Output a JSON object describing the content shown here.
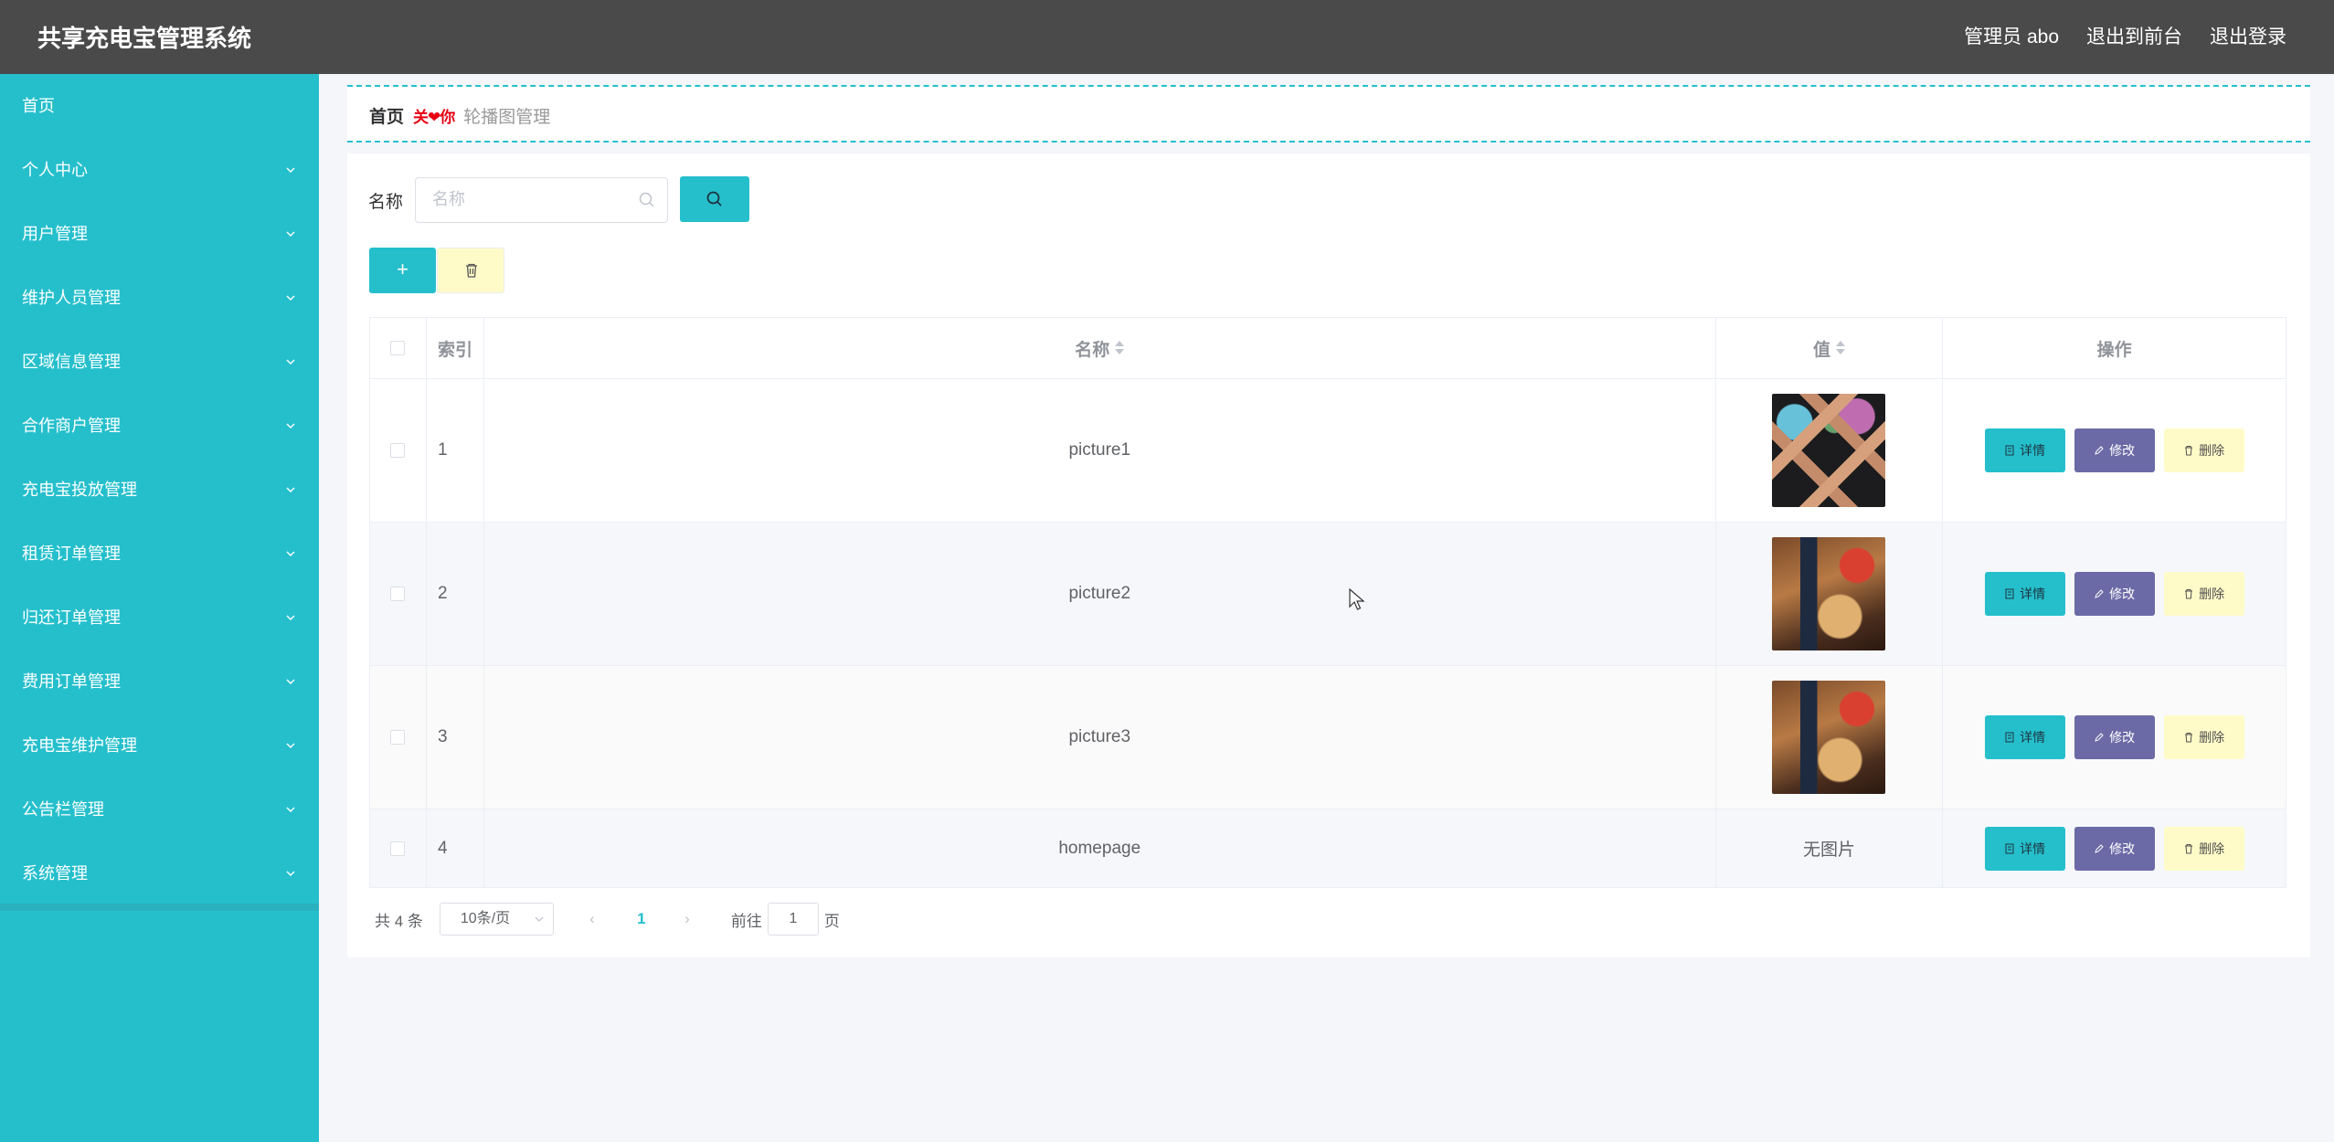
{
  "app": {
    "title": "共享充电宝管理系统"
  },
  "header": {
    "links": [
      "管理员 abo",
      "退出到前台",
      "退出登录"
    ]
  },
  "sidebar": {
    "items": [
      {
        "label": "首页",
        "expandable": false
      },
      {
        "label": "个人中心",
        "expandable": true
      },
      {
        "label": "用户管理",
        "expandable": true
      },
      {
        "label": "维护人员管理",
        "expandable": true
      },
      {
        "label": "区域信息管理",
        "expandable": true
      },
      {
        "label": "合作商户管理",
        "expandable": true
      },
      {
        "label": "充电宝投放管理",
        "expandable": true
      },
      {
        "label": "租赁订单管理",
        "expandable": true
      },
      {
        "label": "归还订单管理",
        "expandable": true
      },
      {
        "label": "费用订单管理",
        "expandable": true
      },
      {
        "label": "充电宝维护管理",
        "expandable": true
      },
      {
        "label": "公告栏管理",
        "expandable": true
      },
      {
        "label": "系统管理",
        "expandable": true
      }
    ]
  },
  "breadcrumb": {
    "home": "首页",
    "separator": "关❤你",
    "current": "轮播图管理"
  },
  "search": {
    "label": "名称",
    "placeholder": "名称",
    "value": ""
  },
  "table": {
    "columns": {
      "index": "索引",
      "name": "名称",
      "value": "值",
      "actions": "操作"
    },
    "rows": [
      {
        "index": "1",
        "name": "picture1",
        "image": "wine-bottles-rack",
        "no_image_text": ""
      },
      {
        "index": "2",
        "name": "picture2",
        "image": "wine-bottle-bar",
        "no_image_text": ""
      },
      {
        "index": "3",
        "name": "picture3",
        "image": "wine-bottle-bar",
        "no_image_text": ""
      },
      {
        "index": "4",
        "name": "homepage",
        "image": "",
        "no_image_text": "无图片"
      }
    ],
    "actions": {
      "detail": "详情",
      "edit": "修改",
      "delete": "删除"
    }
  },
  "pagination": {
    "total": "共 4 条",
    "page_size": "10条/页",
    "current_page": "1",
    "goto_label": "前往",
    "goto_value": "1",
    "page_unit": "页"
  },
  "colors": {
    "accent": "#25bfcc",
    "header_bg": "#4a4a4a",
    "edit_btn": "#6b6aa6",
    "delete_btn": "#fffbc8"
  }
}
